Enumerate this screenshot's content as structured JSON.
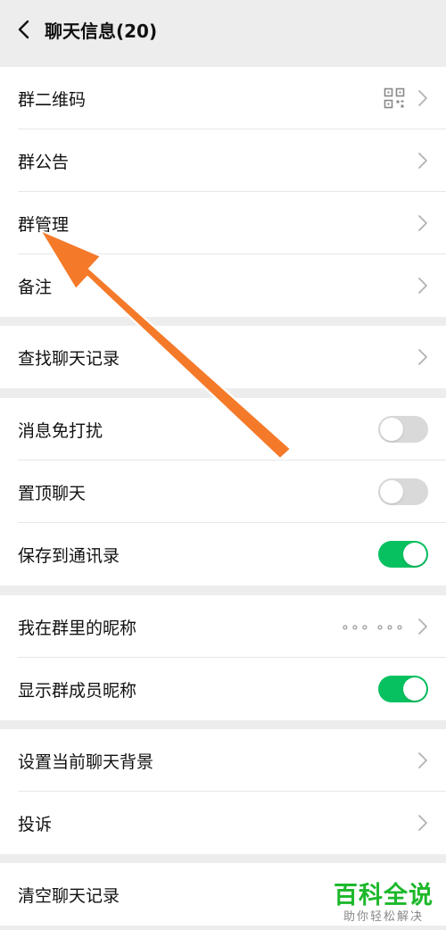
{
  "header": {
    "title": "聊天信息(20)",
    "back_icon": "chevron-left-icon"
  },
  "sections": {
    "group": {
      "qr_code": "群二维码",
      "announcement": "群公告",
      "management": "群管理",
      "remark": "备注"
    },
    "search": {
      "history": "查找聊天记录"
    },
    "settings": {
      "mute": {
        "label": "消息免打扰",
        "state": "off"
      },
      "pin": {
        "label": "置顶聊天",
        "state": "off"
      },
      "save_contacts": {
        "label": "保存到通讯录",
        "state": "on"
      }
    },
    "nickname": {
      "my_nickname": {
        "label": "我在群里的昵称",
        "value": "∘∘∘  ∘∘∘"
      },
      "show_nicknames": {
        "label": "显示群成员昵称",
        "state": "on"
      }
    },
    "misc": {
      "background": "设置当前聊天背景",
      "report": "投诉"
    },
    "danger": {
      "clear": "清空聊天记录"
    }
  },
  "colors": {
    "accent_green": "#07c160",
    "arrow_orange": "#f47a2a",
    "watermark_green": "#1db82b"
  },
  "watermark": {
    "main": "百科全说",
    "sub": "助你轻松解决"
  }
}
